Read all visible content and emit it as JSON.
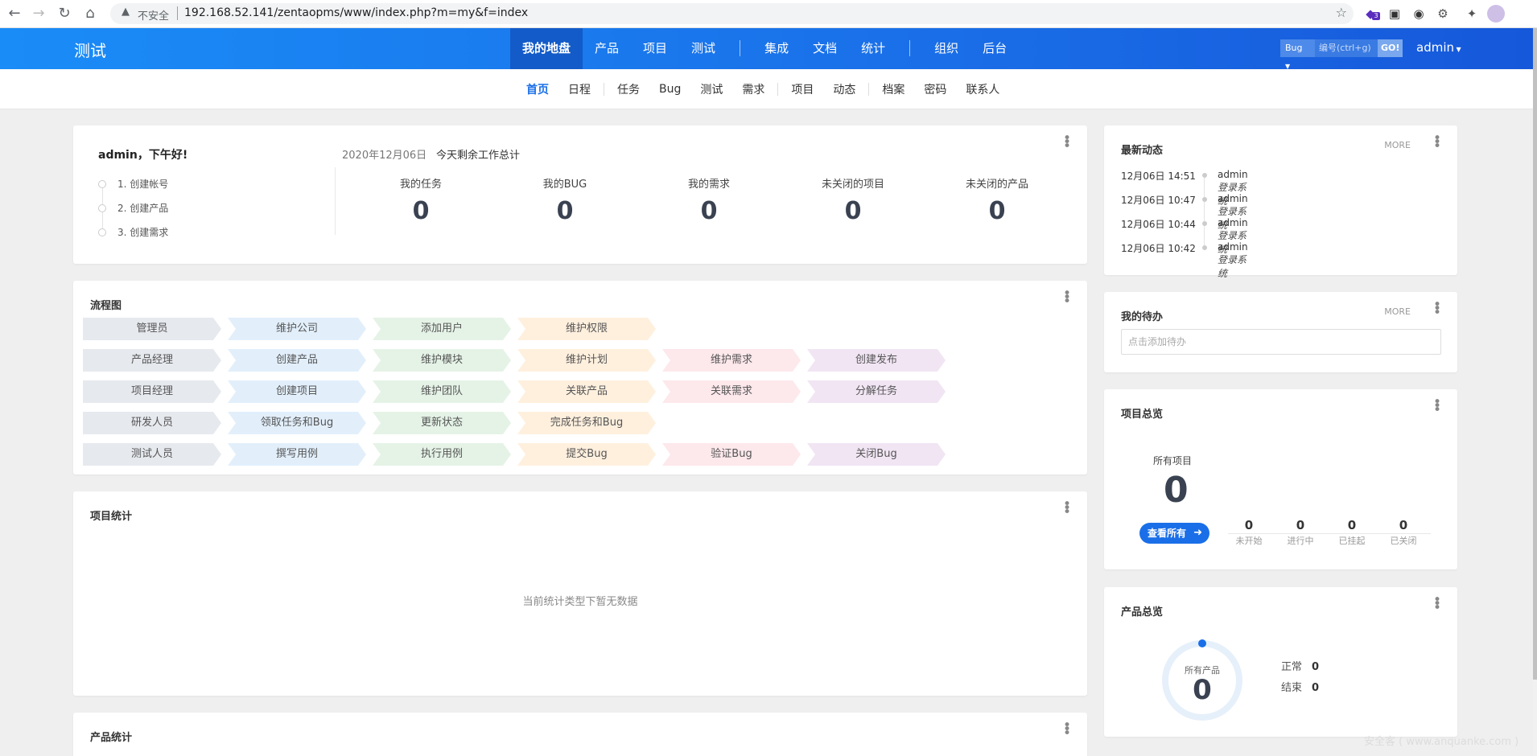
{
  "browser": {
    "security_label": "不安全",
    "url": "192.168.52.141/zentaopms/www/index.php?m=my&f=index",
    "ext_badge": "3"
  },
  "header": {
    "brand": "测试",
    "nav": [
      "我的地盘",
      "产品",
      "项目",
      "测试",
      "集成",
      "文档",
      "统计",
      "组织",
      "后台"
    ],
    "search_type": "Bug",
    "search_placeholder": "编号(ctrl+g)",
    "search_go": "GO!",
    "user": "admin"
  },
  "subnav": [
    "首页",
    "日程",
    "任务",
    "Bug",
    "测试",
    "需求",
    "项目",
    "动态",
    "档案",
    "密码",
    "联系人"
  ],
  "welcome": {
    "greeting": "admin，下午好!",
    "steps": [
      "1. 创建帐号",
      "2. 创建产品",
      "3. 创建需求"
    ],
    "date": "2020年12月06日",
    "summary": "今天剩余工作总计",
    "stats": [
      {
        "label": "我的任务",
        "value": "0"
      },
      {
        "label": "我的BUG",
        "value": "0"
      },
      {
        "label": "我的需求",
        "value": "0"
      },
      {
        "label": "未关闭的项目",
        "value": "0"
      },
      {
        "label": "未关闭的产品",
        "value": "0"
      }
    ]
  },
  "flow": {
    "title": "流程图",
    "rows": [
      [
        "管理员",
        "维护公司",
        "添加用户",
        "维护权限"
      ],
      [
        "产品经理",
        "创建产品",
        "维护模块",
        "维护计划",
        "维护需求",
        "创建发布"
      ],
      [
        "项目经理",
        "创建项目",
        "维护团队",
        "关联产品",
        "关联需求",
        "分解任务"
      ],
      [
        "研发人员",
        "领取任务和Bug",
        "更新状态",
        "完成任务和Bug"
      ],
      [
        "测试人员",
        "撰写用例",
        "执行用例",
        "提交Bug",
        "验证Bug",
        "关闭Bug"
      ]
    ]
  },
  "project_stats": {
    "title": "项目统计",
    "empty": "当前统计类型下暂无数据"
  },
  "product_stats": {
    "title": "产品统计"
  },
  "dynamics": {
    "title": "最新动态",
    "more": "MORE",
    "items": [
      {
        "time": "12月06日 14:51",
        "user": "admin",
        "action": "登录系统"
      },
      {
        "time": "12月06日 10:47",
        "user": "admin",
        "action": "登录系统"
      },
      {
        "time": "12月06日 10:44",
        "user": "admin",
        "action": "登录系统"
      },
      {
        "time": "12月06日 10:42",
        "user": "admin",
        "action": "登录系统"
      }
    ]
  },
  "todo": {
    "title": "我的待办",
    "more": "MORE",
    "placeholder": "点击添加待办"
  },
  "project_overview": {
    "title": "项目总览",
    "all_label": "所有项目",
    "all_value": "0",
    "view_all": "查看所有",
    "stats": [
      {
        "label": "未开始",
        "value": "0"
      },
      {
        "label": "进行中",
        "value": "0"
      },
      {
        "label": "已挂起",
        "value": "0"
      },
      {
        "label": "已关闭",
        "value": "0"
      }
    ]
  },
  "product_overview": {
    "title": "产品总览",
    "ring_label": "所有产品",
    "ring_value": "0",
    "normal_label": "正常",
    "normal_value": "0",
    "closed_label": "结束",
    "closed_value": "0"
  },
  "watermark": "安全客 ( www.anquanke.com )"
}
